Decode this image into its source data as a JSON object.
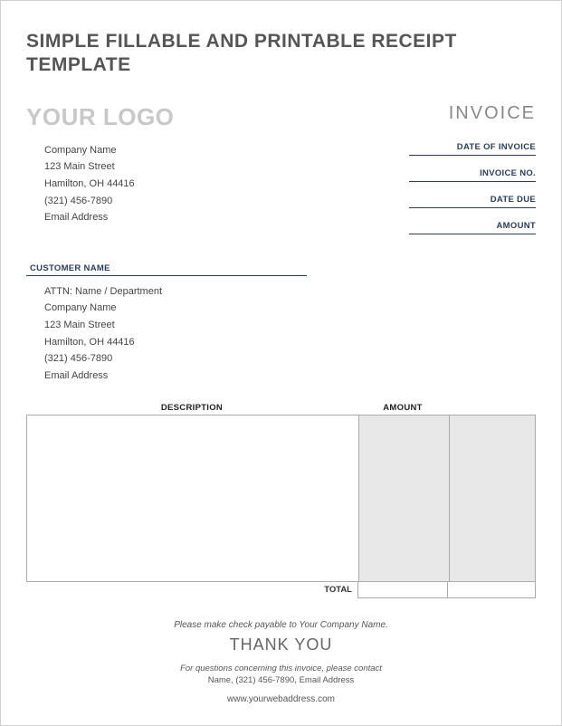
{
  "title": "SIMPLE FILLABLE AND PRINTABLE RECEIPT TEMPLATE",
  "logo_placeholder": "YOUR LOGO",
  "invoice_label": "INVOICE",
  "company": {
    "name": "Company Name",
    "street": "123 Main Street",
    "city_line": "Hamilton, OH  44416",
    "phone": "(321) 456-7890",
    "email": "Email Address"
  },
  "meta": {
    "date_of_invoice": "DATE OF INVOICE",
    "invoice_no": "INVOICE NO.",
    "date_due": "DATE DUE",
    "amount": "AMOUNT"
  },
  "customer_label": "CUSTOMER NAME",
  "customer": {
    "attn": "ATTN: Name / Department",
    "name": "Company Name",
    "street": "123 Main Street",
    "city_line": "Hamilton, OH  44416",
    "phone": "(321) 456-7890",
    "email": "Email Address"
  },
  "table": {
    "description_header": "DESCRIPTION",
    "amount_header": "AMOUNT",
    "total_label": "TOTAL"
  },
  "footer": {
    "payable": "Please make check payable to Your Company Name.",
    "thanks": "THANK YOU",
    "contact": "For questions concerning this invoice, please contact",
    "contact_info": "Name, (321) 456-7890, Email Address",
    "web": "www.yourwebaddress.com"
  }
}
